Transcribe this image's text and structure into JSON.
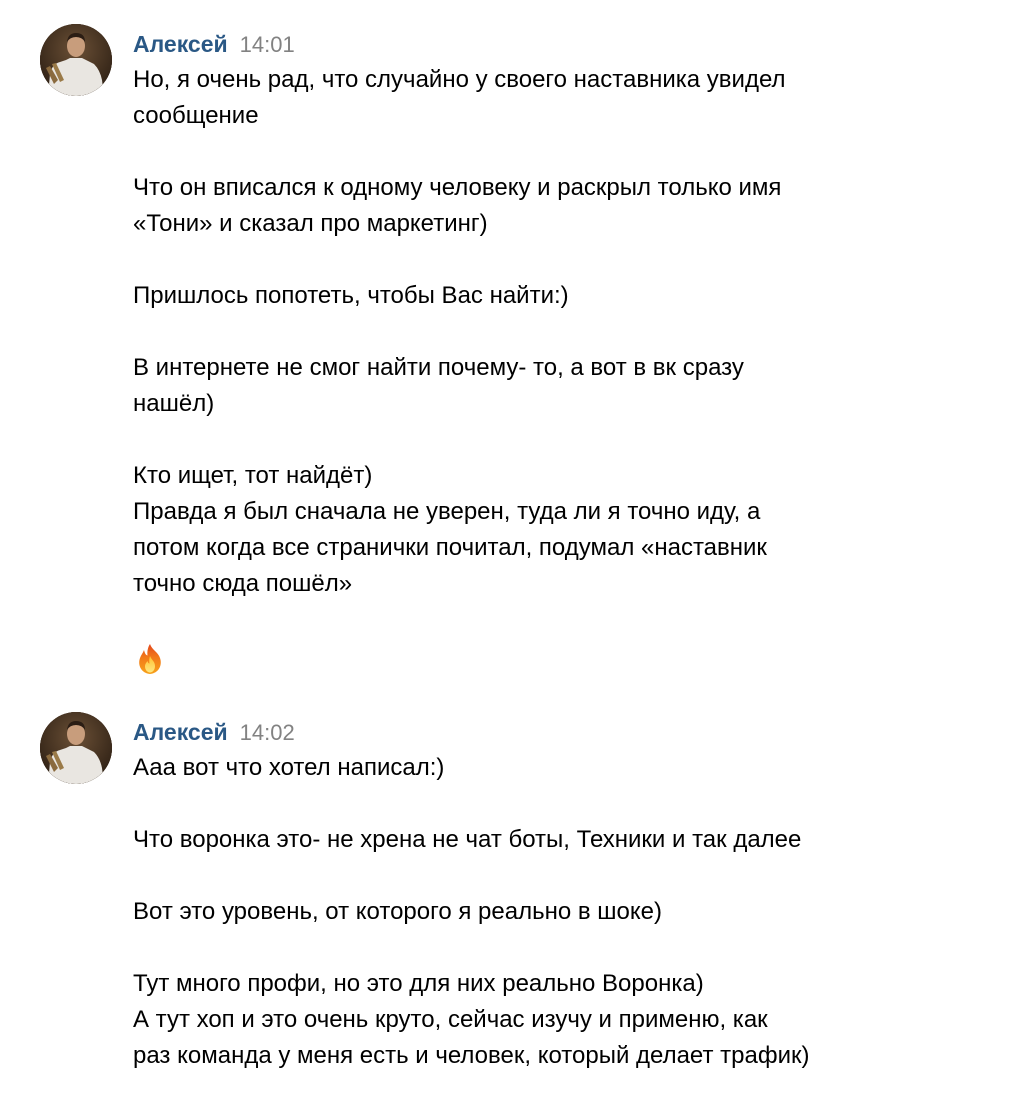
{
  "messages": [
    {
      "author": "Алексей",
      "time": "14:01",
      "avatar_icon": "user-photo-avatar",
      "lines": [
        "Но, я очень рад, что случайно у своего наставника увидел",
        "сообщение",
        "",
        "Что он вписался к одному человеку и раскрыл только имя",
        "«Тони» и сказал про маркетинг)",
        "",
        "Пришлось попотеть, чтобы Вас найти:)",
        "",
        "В интернете не смог найти почему- то, а вот в вк сразу",
        "нашёл)",
        "",
        "Кто ищет, тот найдёт)",
        "Правда я был сначала не уверен, туда ли я точно иду, а",
        "потом когда все странички почитал, подумал «наставник",
        "точно сюда пошёл»",
        ""
      ],
      "emoji": "fire-emoji-icon"
    },
    {
      "author": "Алексей",
      "time": "14:02",
      "avatar_icon": "user-photo-avatar",
      "lines": [
        "Ааа вот что хотел написал:)",
        "",
        "Что воронка это- не хрена не чат боты, Техники и так далее",
        "",
        "Вот это уровень, от которого я реально в шоке)",
        "",
        "Тут много профи, но это для них реально Воронка)",
        "А тут хоп и это очень круто, сейчас изучу и применю, как",
        "раз команда у меня есть и человек, который делает трафик)"
      ]
    }
  ],
  "colors": {
    "author": "#2a5885",
    "time": "#828282",
    "text": "#000000",
    "background": "#ffffff"
  }
}
